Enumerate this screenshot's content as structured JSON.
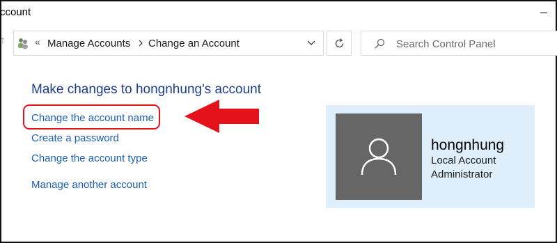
{
  "window": {
    "title": "ccount"
  },
  "address_bar": {
    "breadcrumb": [
      "Manage Accounts",
      "Change an Account"
    ],
    "prefix": "«"
  },
  "search": {
    "placeholder": "Search Control Panel"
  },
  "main": {
    "heading": "Make changes to hongnhung's account",
    "tasks": [
      "Change the account name",
      "Create a password",
      "Change the account type",
      "Manage another account"
    ]
  },
  "account": {
    "name": "hongnhung",
    "type": "Local Account",
    "role": "Administrator"
  },
  "colors": {
    "link": "#1a5fb4",
    "heading": "#1e3e8a",
    "highlight": "#e3121b",
    "panel_bg": "#deeefb",
    "avatar_bg": "#666666"
  }
}
